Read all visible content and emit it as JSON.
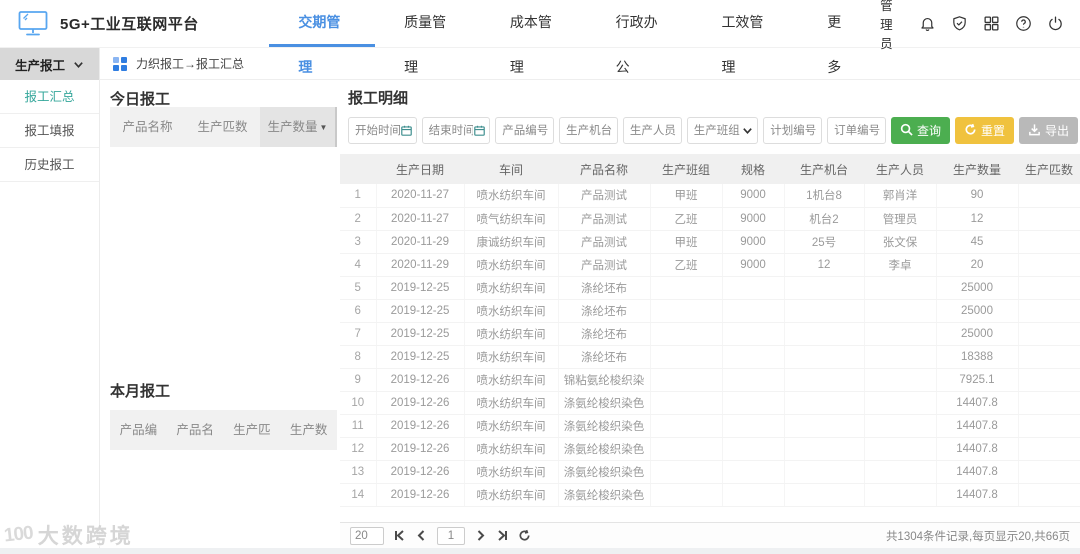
{
  "topbar": {
    "title": "5G+工业互联网平台",
    "nav": [
      {
        "label": "交期管理",
        "active": true
      },
      {
        "label": "质量管理",
        "active": false
      },
      {
        "label": "成本管理",
        "active": false
      },
      {
        "label": "行政办公",
        "active": false
      },
      {
        "label": "工效管理",
        "active": false
      },
      {
        "label": "更多",
        "active": false
      }
    ],
    "user": "管理员",
    "icons": [
      "bell-icon",
      "shield-check-icon",
      "apps-grid-icon",
      "help-icon",
      "power-icon"
    ]
  },
  "sidebar": {
    "group_label": "生产报工",
    "items": [
      {
        "label": "报工汇总",
        "active": true
      },
      {
        "label": "报工填报",
        "active": false
      },
      {
        "label": "历史报工",
        "active": false
      }
    ]
  },
  "breadcrumb": "力织报工→报工汇总",
  "today_panel": {
    "title": "今日报工",
    "headers": [
      "产品名称",
      "生产匹数",
      "生产数量"
    ],
    "sorted_column": "生产数量",
    "sort_direction": "desc"
  },
  "month_panel": {
    "title": "本月报工",
    "headers": [
      "产品编",
      "产品名",
      "生产匹",
      "生产数"
    ]
  },
  "detail_panel": {
    "title": "报工明细",
    "filters": [
      {
        "placeholder": "开始时间",
        "type": "date"
      },
      {
        "placeholder": "结束时间",
        "type": "date"
      },
      {
        "placeholder": "产品编号",
        "type": "text"
      },
      {
        "placeholder": "生产机台",
        "type": "text"
      },
      {
        "placeholder": "生产人员",
        "type": "text"
      },
      {
        "placeholder": "生产班组",
        "type": "select"
      },
      {
        "placeholder": "计划编号",
        "type": "text"
      },
      {
        "placeholder": "订单编号",
        "type": "text"
      }
    ],
    "buttons": {
      "search": "查询",
      "reset": "重置",
      "export": "导出"
    },
    "table": {
      "headers": [
        "",
        "生产日期",
        "车间",
        "产品名称",
        "生产班组",
        "规格",
        "生产机台",
        "生产人员",
        "生产数量",
        "生产匹数"
      ],
      "rows": [
        [
          "1",
          "2020-11-27",
          "喷水纺织车间",
          "产品测试",
          "甲班",
          "9000",
          "1机台8",
          "郭肖洋",
          "90",
          ""
        ],
        [
          "2",
          "2020-11-27",
          "喷气纺织车间",
          "产品测试",
          "乙班",
          "9000",
          "机台2",
          "管理员",
          "12",
          ""
        ],
        [
          "3",
          "2020-11-29",
          "康诚纺织车间",
          "产品测试",
          "甲班",
          "9000",
          "25号",
          "张文保",
          "45",
          ""
        ],
        [
          "4",
          "2020-11-29",
          "喷水纺织车间",
          "产品测试",
          "乙班",
          "9000",
          "12",
          "李卓",
          "20",
          ""
        ],
        [
          "5",
          "2019-12-25",
          "喷水纺织车间",
          "涤纶坯布",
          "",
          "",
          "",
          "",
          "25000",
          ""
        ],
        [
          "6",
          "2019-12-25",
          "喷水纺织车间",
          "涤纶坯布",
          "",
          "",
          "",
          "",
          "25000",
          ""
        ],
        [
          "7",
          "2019-12-25",
          "喷水纺织车间",
          "涤纶坯布",
          "",
          "",
          "",
          "",
          "25000",
          ""
        ],
        [
          "8",
          "2019-12-25",
          "喷水纺织车间",
          "涤纶坯布",
          "",
          "",
          "",
          "",
          "18388",
          ""
        ],
        [
          "9",
          "2019-12-26",
          "喷水纺织车间",
          "锦粘氨纶梭织染",
          "",
          "",
          "",
          "",
          "7925.1",
          ""
        ],
        [
          "10",
          "2019-12-26",
          "喷水纺织车间",
          "涤氨纶梭织染色",
          "",
          "",
          "",
          "",
          "14407.8",
          ""
        ],
        [
          "11",
          "2019-12-26",
          "喷水纺织车间",
          "涤氨纶梭织染色",
          "",
          "",
          "",
          "",
          "14407.8",
          ""
        ],
        [
          "12",
          "2019-12-26",
          "喷水纺织车间",
          "涤氨纶梭织染色",
          "",
          "",
          "",
          "",
          "14407.8",
          ""
        ],
        [
          "13",
          "2019-12-26",
          "喷水纺织车间",
          "涤氨纶梭织染色",
          "",
          "",
          "",
          "",
          "14407.8",
          ""
        ],
        [
          "14",
          "2019-12-26",
          "喷水纺织车间",
          "涤氨纶梭织染色",
          "",
          "",
          "",
          "",
          "14407.8",
          ""
        ]
      ]
    },
    "pagination": {
      "page_size": "20",
      "current_page": "1",
      "summary": "共1304条件记录,每页显示20,共66页"
    }
  },
  "watermark": {
    "brand_mark": "100",
    "text": "大数跨境"
  },
  "colors": {
    "nav_active_blue": "#4a90e2",
    "sidebar_active_teal": "#35a79b",
    "search_green": "#4cae50",
    "reset_yellow": "#f0c23e",
    "export_gray": "#b9b9b9",
    "logo_blue": "#58a6f0",
    "breadcrumb_blue": "#2f7de1"
  }
}
